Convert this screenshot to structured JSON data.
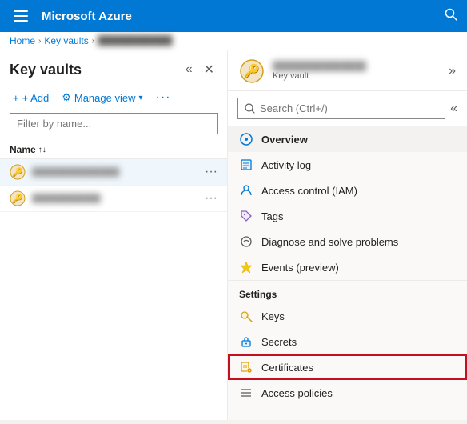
{
  "topbar": {
    "title": "Microsoft Azure",
    "hamburger_label": "☰",
    "search_icon": "🔍"
  },
  "breadcrumb": {
    "home": "Home",
    "keyvaults": "Key vaults",
    "current": "████████████"
  },
  "leftPanel": {
    "title": "Key vaults",
    "collapse_icon": "«",
    "close_icon": "✕",
    "add_label": "+ Add",
    "manageview_label": "Manage view",
    "more_label": "···",
    "filter_placeholder": "Filter by name...",
    "column_name": "Name",
    "sort_icon": "↑↓",
    "items": [
      {
        "name": "██████████████",
        "id": "item-1"
      },
      {
        "name": "███████████",
        "id": "item-2"
      }
    ]
  },
  "rightPanel": {
    "vault_name": "███████████████",
    "vault_type": "Key vault",
    "search_placeholder": "Search (Ctrl+/)",
    "collapse_icon": "»",
    "nav_items": [
      {
        "id": "overview",
        "label": "Overview",
        "icon": "overview",
        "active": true
      },
      {
        "id": "activitylog",
        "label": "Activity log",
        "icon": "actlog"
      },
      {
        "id": "iam",
        "label": "Access control (IAM)",
        "icon": "iam"
      },
      {
        "id": "tags",
        "label": "Tags",
        "icon": "tags"
      },
      {
        "id": "diagnose",
        "label": "Diagnose and solve problems",
        "icon": "diagnose"
      },
      {
        "id": "events",
        "label": "Events (preview)",
        "icon": "events"
      }
    ],
    "settings_label": "Settings",
    "settings_items": [
      {
        "id": "keys",
        "label": "Keys",
        "icon": "keys"
      },
      {
        "id": "secrets",
        "label": "Secrets",
        "icon": "secrets"
      },
      {
        "id": "certificates",
        "label": "Certificates",
        "icon": "certs",
        "highlighted": true
      },
      {
        "id": "accesspolicies",
        "label": "Access policies",
        "icon": "access"
      }
    ]
  }
}
